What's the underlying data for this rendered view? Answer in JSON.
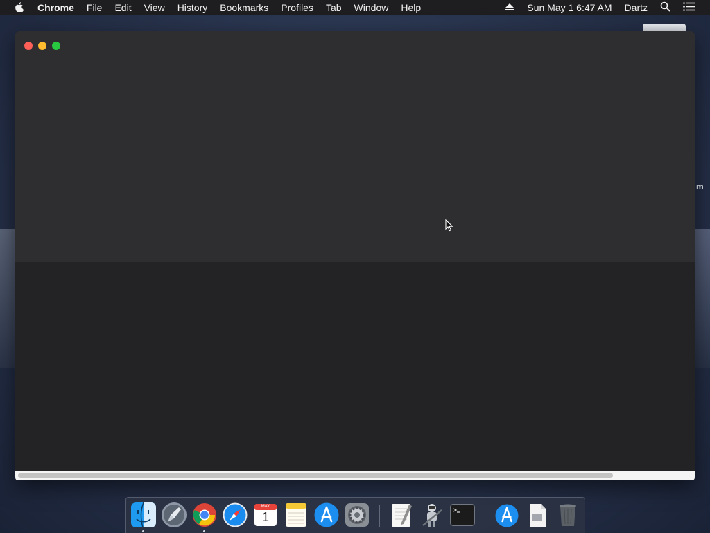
{
  "menubar": {
    "app_name": "Chrome",
    "items": [
      "File",
      "Edit",
      "View",
      "History",
      "Bookmarks",
      "Profiles",
      "Tab",
      "Window",
      "Help"
    ],
    "clock": "Sun May 1  6:47 AM",
    "user": "Dartz"
  },
  "desktop": {
    "partial_label": "m"
  },
  "dock": {
    "calendar_month": "MAY",
    "calendar_day": "1",
    "apps": [
      "finder-icon",
      "launchpad-icon",
      "chrome-icon",
      "safari-icon",
      "calendar-icon",
      "notes-icon",
      "app-store-icon",
      "system-preferences-icon",
      "textedit-icon",
      "automator-icon",
      "terminal-icon",
      "app-store-downloads-icon",
      "document-icon",
      "trash-icon"
    ]
  },
  "colors": {
    "close": "#fe5f57",
    "minimize": "#febc2e",
    "maximize": "#28c840"
  }
}
